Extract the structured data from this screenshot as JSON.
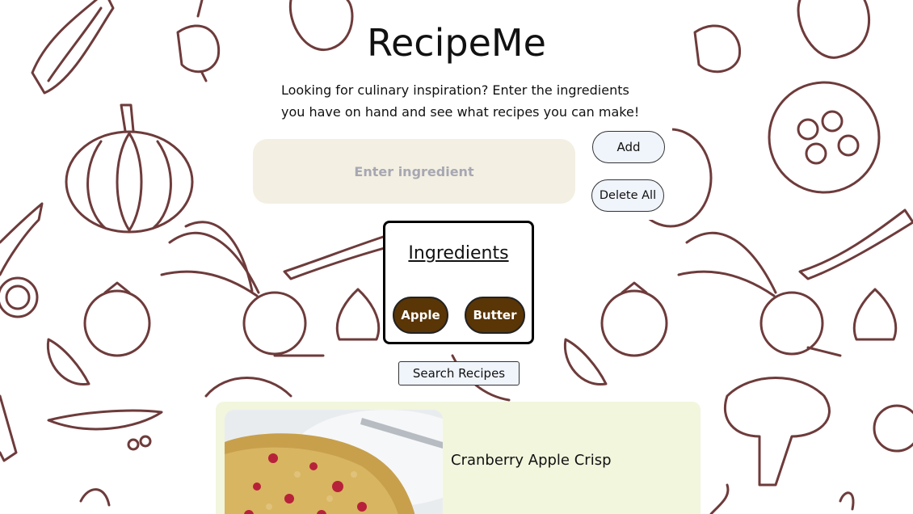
{
  "app": {
    "title": "RecipeMe",
    "intro": "Looking for culinary inspiration? Enter the ingredients you have on hand and see what recipes you can make!"
  },
  "form": {
    "input_placeholder": "Enter ingredient",
    "input_value": "",
    "add_label": "Add",
    "delete_all_label": "Delete All"
  },
  "ingredients": {
    "heading": "Ingredients",
    "items": [
      {
        "label": "Apple"
      },
      {
        "label": "Butter"
      }
    ]
  },
  "search": {
    "label": "Search Recipes"
  },
  "results": [
    {
      "title": "Cranberry Apple Crisp",
      "image_icon": "recipe-photo"
    }
  ],
  "colors": {
    "sketch": "#6e3b3b",
    "input_bg": "#f3efe2",
    "chip_bg": "#5a3505",
    "button_bg": "#f0f4fb",
    "card_bg": "#f1f6dd"
  }
}
